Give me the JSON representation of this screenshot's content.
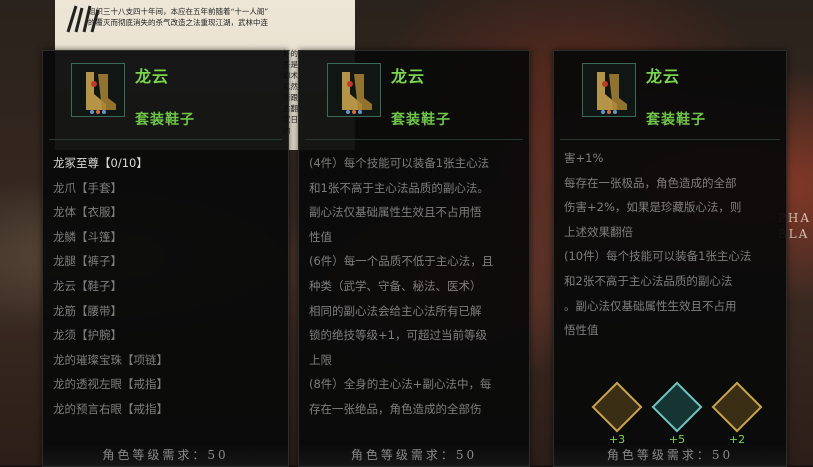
{
  "background": {
    "paper_lines": [
      "组织三十八支四十年间，本应在五年前随着“十一人阁”",
      "的覆灭而彻底消失的杀气改造之法重现江湖，武林中连"
    ],
    "paper_side_lines": [
      "好的",
      "吾是",
      "幻术",
      "以然",
      "所跟",
      "古翻",
      "汉日",
      "的"
    ],
    "right_deco": [
      "PHA",
      "BLA"
    ]
  },
  "panels": [
    {
      "item_name": "龙云",
      "item_type": "套装鞋子",
      "lines": [
        "龙冢至尊【0/10】",
        "龙爪【手套】",
        "龙体【衣服】",
        "龙鳞【斗篷】",
        "龙腿【裤子】",
        "龙云【鞋子】",
        "龙筋【腰带】",
        "龙须【护腕】",
        "龙的璀璨宝珠【项链】",
        "龙的透视左眼【戒指】",
        "龙的预言右眼【戒指】"
      ],
      "requirement": "角色等级需求：50"
    },
    {
      "item_name": "龙云",
      "item_type": "套装鞋子",
      "lines": [
        "(4件）每个技能可以装备1张主心法",
        "和1张不高于主心法品质的副心法。",
        "副心法仅基础属性生效且不占用悟",
        "性值",
        "(6件）每一个品质不低于主心法，且",
        "种类（武学、守备、秘法、医术）",
        "相同的副心法会给主心法所有已解",
        "锁的绝技等级+1，可超过当前等级",
        "上限",
        "(8件）全身的主心法+副心法中，每",
        "存在一张绝品，角色造成的全部伤"
      ],
      "line8_highlight": "绝品",
      "requirement": "角色等级需求：50"
    },
    {
      "item_name": "龙云",
      "item_type": "套装鞋子",
      "lines": [
        "害+1%",
        "每存在一张极品，角色造成的全部",
        "伤害+2%，如果是珍藏版心法，则",
        "上述效果翻倍",
        "(10件）每个技能可以装备1张主心法",
        "和2张不高于主心法品质的副心法",
        "。副心法仅基础属性生效且不占用",
        "悟性值"
      ],
      "skills": [
        {
          "name": "skill-1",
          "level": "+3",
          "color": "#c9a24a"
        },
        {
          "name": "skill-2",
          "level": "+5",
          "color": "#6fc3c0"
        },
        {
          "name": "skill-3",
          "level": "+2",
          "color": "#c9a24a"
        }
      ],
      "requirement": "角色等级需求：50"
    }
  ],
  "colors": {
    "item_name": "#79d64a",
    "panel_bg": "#080a0a",
    "text": "#7e7e7e",
    "rarity_orange": "#e0a24a",
    "rarity_red": "#e0644a",
    "rarity_purple": "#9a7ae6"
  }
}
